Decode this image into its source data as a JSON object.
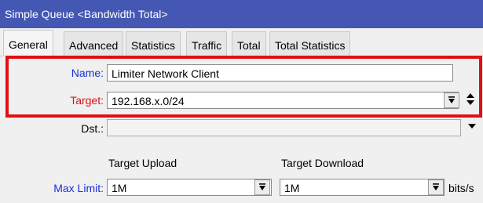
{
  "window": {
    "title": "Simple Queue <Bandwidth Total>"
  },
  "tabs": [
    {
      "label": "General"
    },
    {
      "label": "Advanced"
    },
    {
      "label": "Statistics"
    },
    {
      "label": "Traffic"
    },
    {
      "label": "Total"
    },
    {
      "label": "Total Statistics"
    }
  ],
  "form": {
    "name": {
      "label": "Name:",
      "value": "Limiter Network Client"
    },
    "target": {
      "label": "Target:",
      "value": "192.168.x.0/24",
      "dropdown_icon": "dropdown-icon",
      "updown_icon": "updown-arrows-icon"
    },
    "dst": {
      "label": "Dst.:",
      "value": "",
      "dropdown_icon": "dropdown-arrow-icon"
    },
    "columns": {
      "upload": "Target Upload",
      "download": "Target Download"
    },
    "max_limit": {
      "label": "Max Limit:",
      "upload": "1M",
      "download": "1M",
      "unit": "bits/s"
    }
  },
  "colors": {
    "titlebar": "#4458b3",
    "highlight_border": "#e01010",
    "label_blue": "#1a2fd8",
    "label_red": "#d41515"
  }
}
